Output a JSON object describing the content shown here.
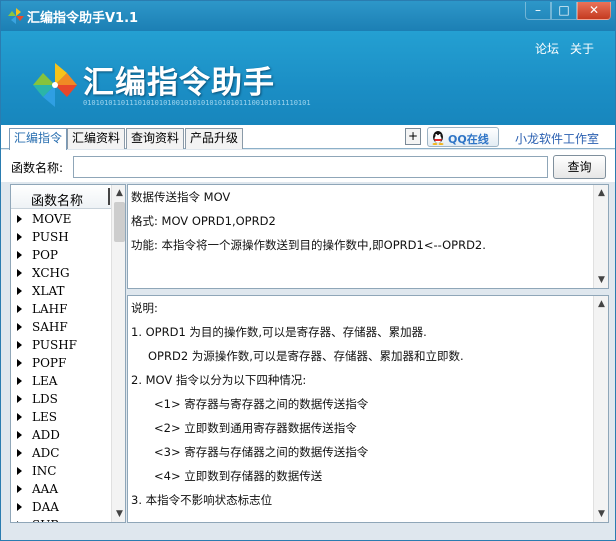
{
  "window": {
    "title": "汇编指令助手V1.1",
    "controls": {
      "minimize": "–",
      "maximize": "□",
      "close": "✕"
    }
  },
  "banner": {
    "links": {
      "forum": "论坛",
      "about": "关于"
    },
    "logo_title": "汇编指令助手",
    "logo_binary": "010101011011101010101001010101010101011100101011110101"
  },
  "tabs": [
    {
      "label": "汇编指令",
      "active": true
    },
    {
      "label": "汇编资料",
      "active": false
    },
    {
      "label": "查询资料",
      "active": false
    },
    {
      "label": "产品升级",
      "active": false
    }
  ],
  "toolbar": {
    "plus_label": "+",
    "qq_label": "QQ在线",
    "studio_label": "小龙软件工作室"
  },
  "search": {
    "label": "函数名称:",
    "value": "",
    "button_label": "查询"
  },
  "list": {
    "header": "函数名称",
    "items": [
      "MOVE",
      "PUSH",
      "POP",
      "XCHG",
      "XLAT",
      "LAHF",
      "SAHF",
      "PUSHF",
      "POPF",
      "LEA",
      "LDS",
      "LES",
      "ADD",
      "ADC",
      "INC",
      "AAA",
      "DAA",
      "SUB"
    ]
  },
  "info": {
    "title": "数据传送指令 MOV",
    "format": "格式: MOV OPRD1,OPRD2",
    "function": "功能: 本指令将一个源操作数送到目的操作数中,即OPRD1<--OPRD2."
  },
  "desc": {
    "heading": "说明:",
    "line1": "1. OPRD1 为目的操作数,可以是寄存器、存储器、累加器.",
    "line2": "OPRD2 为源操作数,可以是寄存器、存储器、累加器和立即数.",
    "line3": "2. MOV 指令以分为以下四种情况:",
    "sub1": "<1> 寄存器与寄存器之间的数据传送指令",
    "sub2": "<2> 立即数到通用寄存器数据传送指令",
    "sub3": "<3> 寄存器与存储器之间的数据传送指令",
    "sub4": "<4> 立即数到存储器的数据传送",
    "line4": "3. 本指令不影响状态标志位"
  },
  "colors": {
    "titlebar": "#1c7fb4",
    "banner": "#1b8ec5",
    "active_tab_text": "#2a6fb0",
    "link": "#2a5fb0"
  }
}
